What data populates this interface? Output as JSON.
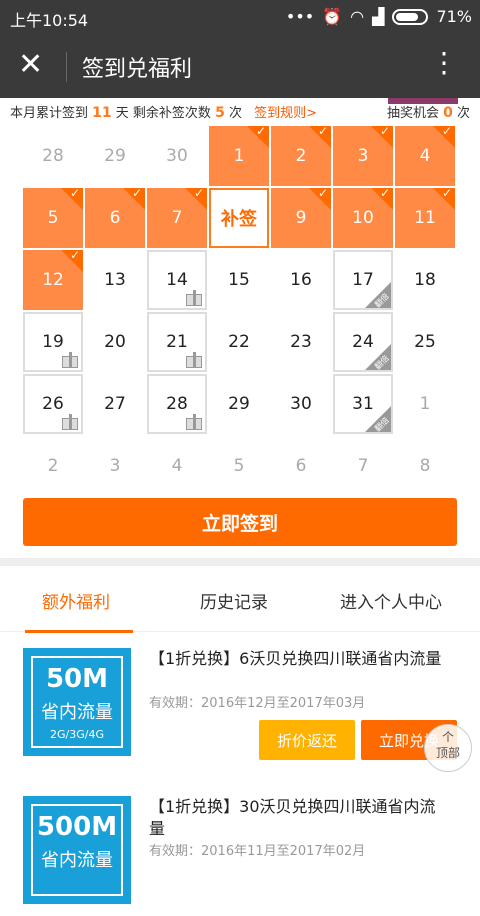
{
  "status": {
    "time": "上午10:54",
    "battery": "71%"
  },
  "header": {
    "title": "签到兑福利"
  },
  "info": {
    "prefix": "本月累计签到",
    "signed_count": "11",
    "mid": "天 剩余补签次数",
    "makeup_count": "5",
    "suffix": "次",
    "rules_link": "签到规则>",
    "lottery_label": "抽奖机会",
    "lottery_count": "0",
    "lottery_suffix": "次"
  },
  "calendar": {
    "makeup_label": "补签",
    "badge_text": "翻倍",
    "rows": [
      [
        "28",
        "29",
        "30",
        "1",
        "2",
        "3",
        "4"
      ],
      [
        "5",
        "6",
        "7",
        "补签",
        "9",
        "10",
        "11"
      ],
      [
        "12",
        "13",
        "14",
        "15",
        "16",
        "17",
        "18"
      ],
      [
        "19",
        "20",
        "21",
        "22",
        "23",
        "24",
        "25"
      ],
      [
        "26",
        "27",
        "28",
        "29",
        "30",
        "31",
        "1"
      ],
      [
        "2",
        "3",
        "4",
        "5",
        "6",
        "7",
        "8"
      ]
    ]
  },
  "sign_button": "立即签到",
  "tabs": [
    "额外福利",
    "历史记录",
    "进入个人中心"
  ],
  "items": [
    {
      "thumb_big": "50M",
      "thumb_mid": "省内流量",
      "thumb_small": "2G/3G/4G",
      "title": "【1折兑换】6沃贝兑换四川联通省内流量",
      "valid": "有效期：2016年12月至2017年03月",
      "btn_refund": "折价返还",
      "btn_redeem": "立即兑换"
    },
    {
      "thumb_big": "500M",
      "thumb_mid": "省内流量",
      "title": "【1折兑换】30沃贝兑换四川联通省内流量",
      "valid": "有效期：2016年11月至2017年02月"
    }
  ],
  "to_top": {
    "line1": "个",
    "line2": "顶部"
  }
}
